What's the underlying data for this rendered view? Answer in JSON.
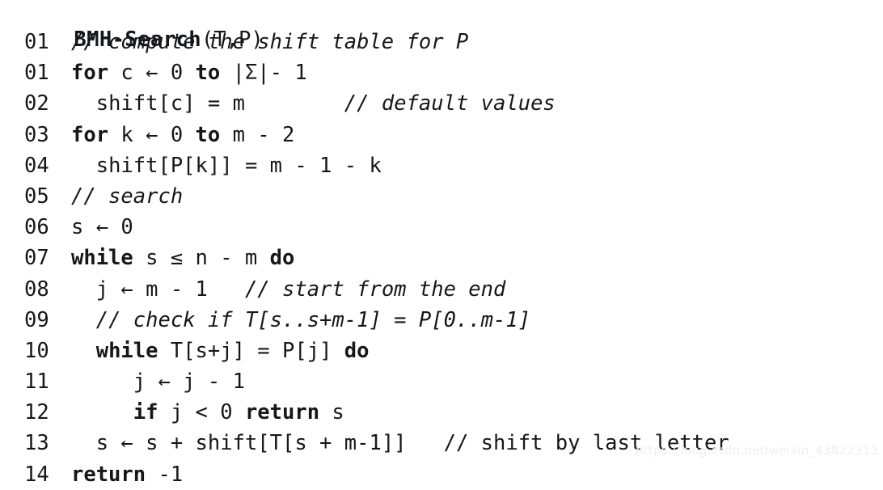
{
  "document": {
    "kind": "pseudocode-listing",
    "title": {
      "name": "BMH-Search",
      "args": "(T,P)"
    },
    "watermark": "https://blog.csdn.net/weixin_43822313",
    "colors": {
      "text": "#16171c",
      "background": "#ffffff",
      "watermark": "#eceff1"
    },
    "lines": [
      {
        "number": "01",
        "indent": "",
        "segments": [
          {
            "text": "// compute the shift table for P",
            "style": "comment-italic"
          }
        ],
        "plain": "01 // compute the shift table for P"
      },
      {
        "number": "01",
        "indent": "",
        "segments": [
          {
            "text": "for",
            "style": "keyword"
          },
          {
            "text": " c ← 0 ",
            "style": "plain"
          },
          {
            "text": "to",
            "style": "keyword"
          },
          {
            "text": " |Σ|- 1",
            "style": "plain"
          }
        ],
        "plain": "01 for c ← 0 to |Σ|- 1"
      },
      {
        "number": "02",
        "indent": "  ",
        "segments": [
          {
            "text": "shift[c] = m",
            "style": "plain"
          },
          {
            "text": "        ",
            "style": "plain"
          },
          {
            "text": "// default values",
            "style": "comment-italic"
          }
        ],
        "plain": "02   shift[c] = m        // default values"
      },
      {
        "number": "03",
        "indent": "",
        "segments": [
          {
            "text": "for",
            "style": "keyword"
          },
          {
            "text": " k ← 0 ",
            "style": "plain"
          },
          {
            "text": "to",
            "style": "keyword"
          },
          {
            "text": " m - 2",
            "style": "plain"
          }
        ],
        "plain": "03 for k ← 0 to m - 2"
      },
      {
        "number": "04",
        "indent": "  ",
        "segments": [
          {
            "text": "shift[P[k]] = m - 1 - k",
            "style": "plain"
          }
        ],
        "plain": "04   shift[P[k]] = m - 1 - k"
      },
      {
        "number": "05",
        "indent": "",
        "segments": [
          {
            "text": "// search",
            "style": "comment-italic"
          }
        ],
        "plain": "05 // search"
      },
      {
        "number": "06",
        "indent": "",
        "segments": [
          {
            "text": "s ← 0",
            "style": "plain"
          }
        ],
        "plain": "06 s ← 0"
      },
      {
        "number": "07",
        "indent": "",
        "segments": [
          {
            "text": "while",
            "style": "keyword"
          },
          {
            "text": " s ≤ n - m ",
            "style": "plain"
          },
          {
            "text": "do",
            "style": "keyword"
          }
        ],
        "plain": "07 while s ≤ n - m do"
      },
      {
        "number": "08",
        "indent": "  ",
        "segments": [
          {
            "text": "j ← m - 1",
            "style": "plain"
          },
          {
            "text": "   ",
            "style": "plain"
          },
          {
            "text": "// start from the end",
            "style": "comment-italic"
          }
        ],
        "plain": "08   j ← m - 1   // start from the end"
      },
      {
        "number": "09",
        "indent": "  ",
        "segments": [
          {
            "text": "// check if T[s..s+m-1] = P[0..m-1]",
            "style": "comment-italic"
          }
        ],
        "plain": "09   // check if T[s..s+m-1] = P[0..m-1]"
      },
      {
        "number": "10",
        "indent": "  ",
        "segments": [
          {
            "text": "while",
            "style": "keyword"
          },
          {
            "text": " T[s+j] = P[j] ",
            "style": "plain"
          },
          {
            "text": "do",
            "style": "keyword"
          }
        ],
        "plain": "10   while T[s+j] = P[j] do"
      },
      {
        "number": "11",
        "indent": "     ",
        "segments": [
          {
            "text": "j ← j - 1",
            "style": "plain"
          }
        ],
        "plain": "11      j ← j - 1"
      },
      {
        "number": "12",
        "indent": "     ",
        "segments": [
          {
            "text": "if",
            "style": "keyword"
          },
          {
            "text": " j < 0 ",
            "style": "plain"
          },
          {
            "text": "return",
            "style": "keyword"
          },
          {
            "text": " s",
            "style": "plain"
          }
        ],
        "plain": "12      if j < 0 return s"
      },
      {
        "number": "13",
        "indent": "  ",
        "segments": [
          {
            "text": "s ← s + shift[T[s + m-1]]",
            "style": "plain"
          },
          {
            "text": "   ",
            "style": "plain"
          },
          {
            "text": "// shift by last letter",
            "style": "comment"
          }
        ],
        "plain": "13   s ← s + shift[T[s + m-1]]   // shift by last letter"
      },
      {
        "number": "14",
        "indent": "",
        "segments": [
          {
            "text": "return",
            "style": "keyword"
          },
          {
            "text": " -1",
            "style": "plain"
          }
        ],
        "plain": "14 return -1"
      }
    ]
  }
}
